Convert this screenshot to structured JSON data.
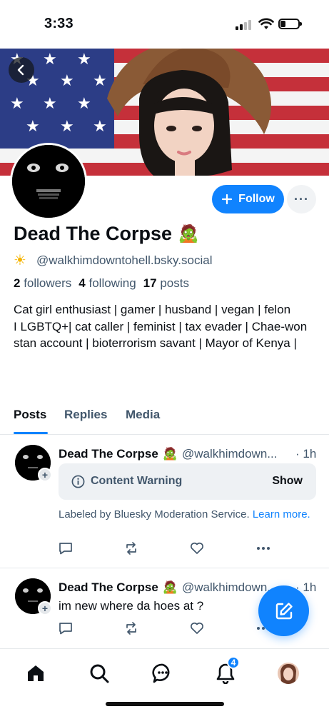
{
  "status_bar": {
    "time": "3:33"
  },
  "profile": {
    "display_name": "Dead The Corpse",
    "name_emoji": "🧟",
    "handle_emoji": "☀",
    "handle": "@walkhimdowntohell.bsky.social",
    "followers_count": "2",
    "followers_label": "followers",
    "following_count": "4",
    "following_label": "following",
    "posts_count": "17",
    "posts_label": "posts",
    "bio_line1": "Cat girl enthusiast | gamer | husband | vegan | felon",
    "bio_line2": "I LGBTQ+| cat caller | feminist | tax evader | Chae-won stan account | bioterrorism savant | Mayor of Kenya |",
    "follow_label": "Follow",
    "more_label": "···"
  },
  "tabs": [
    {
      "label": "Posts",
      "active": true
    },
    {
      "label": "Replies",
      "active": false
    },
    {
      "label": "Media",
      "active": false
    }
  ],
  "posts": [
    {
      "author": "Dead The Corpse",
      "emoji": "🧟",
      "handle": "@walkhimdown...",
      "time": "· 1h",
      "content_warning": "Content Warning",
      "show_label": "Show",
      "label_text": "Labeled by Bluesky Moderation Service.",
      "learn_more": "Learn more."
    },
    {
      "author": "Dead The Corpse",
      "emoji": "🧟",
      "handle": "@walkhimdown...",
      "time": "· 1h",
      "text": "im new where da hoes at ?"
    }
  ],
  "action_icons": [
    "reply-icon",
    "repost-icon",
    "like-icon",
    "more-icon"
  ],
  "nav": {
    "items": [
      "home-icon",
      "search-icon",
      "chat-icon",
      "notifications-icon",
      "profile-avatar"
    ],
    "notification_badge": "4"
  },
  "colors": {
    "accent": "#1083fe",
    "muted": "#42576c",
    "text": "#0b0f14"
  }
}
